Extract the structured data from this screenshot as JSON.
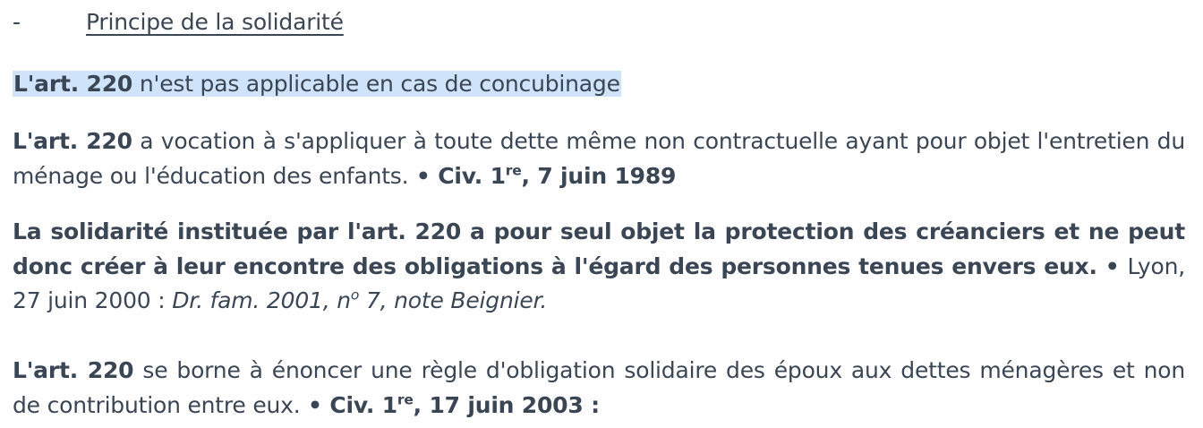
{
  "heading": {
    "dash": "-",
    "title": "Principe de la solidarité"
  },
  "p1": {
    "bold": "L'art. 220",
    "text": " n'est pas applicable en cas de concubinage"
  },
  "p2": {
    "bold": "L'art. 220",
    "text": " a vocation à s'appliquer à toute dette même non contractuelle ayant pour objet l'entretien du ménage ou l'éducation des enfants.",
    "bullet": " • ",
    "cite_a": "Civ. 1",
    "cite_sup": "re",
    "cite_b": ", 7 juin 1989"
  },
  "p3": {
    "bold": "La solidarité instituée par l'art. 220 a pour seul objet la protection des créanciers et ne peut donc créer à leur encontre des obligations à l'égard des personnes tenues envers eux.",
    "bullet": " • ",
    "court": " Lyon, 27 juin 2000 : ",
    "italic_a": "Dr. fam. 2001, n",
    "italic_sup": "o",
    "italic_b": " 7, note Beignier."
  },
  "p4": {
    "bold": "L'art. 220",
    "text": " se borne à énoncer une règle d'obligation solidaire des époux aux dettes ménagères et non de contribution entre eux.",
    "bullet": " • ",
    "cite_a": "Civ. 1",
    "cite_sup": "re",
    "cite_b": ", 17 juin 2003 :"
  }
}
